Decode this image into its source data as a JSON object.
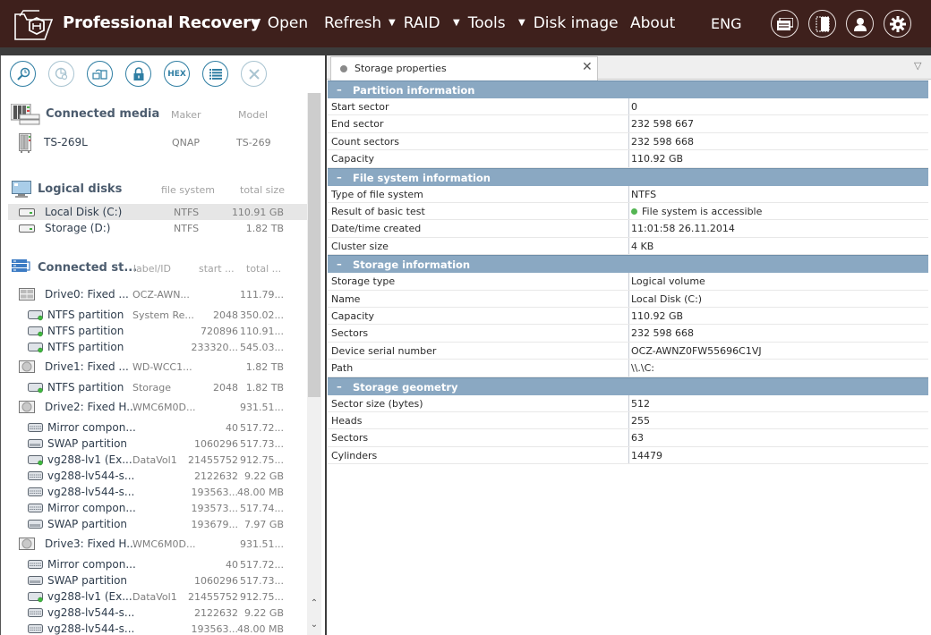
{
  "app": {
    "title": "Professional Recovery",
    "menu": [
      {
        "label": "Open",
        "dropdown": true
      },
      {
        "label": "Refresh",
        "dropdown": false
      },
      {
        "label": "RAID",
        "dropdown": true
      },
      {
        "label": "Tools",
        "dropdown": true
      },
      {
        "label": "Disk image",
        "dropdown": true
      },
      {
        "label": "About",
        "dropdown": false
      }
    ],
    "language": "ENG",
    "header_buttons": [
      "windows-icon",
      "panel-layout-icon",
      "user-icon",
      "settings-gear-icon"
    ],
    "colors": {
      "topbar": "#3e201c",
      "section_header": "#8aa8c2",
      "accent": "#2f7ea3",
      "status_ok": "#54b553"
    }
  },
  "toolbar": {
    "buttons": [
      {
        "icon": "search-scan-icon",
        "enabled": true
      },
      {
        "icon": "chart-search-icon",
        "enabled": false
      },
      {
        "icon": "image-create-icon",
        "enabled": true
      },
      {
        "icon": "lock-icon",
        "enabled": true
      },
      {
        "icon": "hex-icon",
        "label": "HEX",
        "enabled": true
      },
      {
        "icon": "list-icon",
        "enabled": true
      },
      {
        "icon": "close-icon",
        "enabled": false
      }
    ]
  },
  "connected_media": {
    "title": "Connected media",
    "columns": [
      "Maker",
      "Model"
    ],
    "items": [
      {
        "name": "TS-269L",
        "maker": "QNAP",
        "model": "TS-269"
      }
    ]
  },
  "logical_disks": {
    "title": "Logical disks",
    "columns": [
      "file system",
      "total size"
    ],
    "items": [
      {
        "name": "Local Disk (C:)",
        "fs": "NTFS",
        "size": "110.91 GB",
        "selected": true
      },
      {
        "name": "Storage (D:)",
        "fs": "NTFS",
        "size": "1.82 TB",
        "selected": false
      }
    ]
  },
  "connected_storages": {
    "title": "Connected st...",
    "columns": [
      "label/ID",
      "start ...",
      "total ..."
    ],
    "items": [
      {
        "level": 0,
        "icon": "ssd-icon",
        "name": "Drive0: Fixed ...",
        "label": "OCZ-AWN...",
        "start": "",
        "total": "111.79..."
      },
      {
        "level": 1,
        "icon": "partition-icon",
        "name": "NTFS partition",
        "label": "System Re...",
        "start": "2048",
        "total": "350.02..."
      },
      {
        "level": 1,
        "icon": "partition-icon",
        "name": "NTFS partition",
        "label": "",
        "start": "720896",
        "total": "110.91..."
      },
      {
        "level": 1,
        "icon": "partition-icon",
        "name": "NTFS partition",
        "label": "",
        "start": "233320...",
        "total": "545.03..."
      },
      {
        "level": 0,
        "icon": "hdd-icon",
        "name": "Drive1: Fixed ...",
        "label": "WD-WCC1...",
        "start": "",
        "total": "1.82 TB"
      },
      {
        "level": 1,
        "icon": "partition-icon",
        "name": "NTFS partition",
        "label": "Storage",
        "start": "2048",
        "total": "1.82 TB"
      },
      {
        "level": 0,
        "icon": "hdd-icon",
        "name": "Drive2: Fixed H...",
        "label": "WMC6M0D...",
        "start": "",
        "total": "931.51..."
      },
      {
        "level": 1,
        "icon": "raid-component-icon",
        "name": "Mirror compon...",
        "label": "",
        "start": "40",
        "total": "517.72..."
      },
      {
        "level": 1,
        "icon": "swap-icon",
        "name": "SWAP partition",
        "label": "",
        "start": "1060296",
        "total": "517.73..."
      },
      {
        "level": 1,
        "icon": "partition-icon",
        "name": "vg288-lv1 (Ex...",
        "label": "DataVol1",
        "start": "21455752",
        "total": "912.75..."
      },
      {
        "level": 1,
        "icon": "raid-component-icon",
        "name": "vg288-lv544-s...",
        "label": "",
        "start": "2122632",
        "total": "9.22 GB"
      },
      {
        "level": 1,
        "icon": "raid-component-icon",
        "name": "vg288-lv544-s...",
        "label": "",
        "start": "193563...",
        "total": "48.00 MB"
      },
      {
        "level": 1,
        "icon": "raid-component-icon",
        "name": "Mirror compon...",
        "label": "",
        "start": "193573...",
        "total": "517.74..."
      },
      {
        "level": 1,
        "icon": "swap-icon",
        "name": "SWAP partition",
        "label": "",
        "start": "193679...",
        "total": "7.97 GB"
      },
      {
        "level": 0,
        "icon": "hdd-icon",
        "name": "Drive3: Fixed H...",
        "label": "WMC6M0D...",
        "start": "",
        "total": "931.51..."
      },
      {
        "level": 1,
        "icon": "raid-component-icon",
        "name": "Mirror compon...",
        "label": "",
        "start": "40",
        "total": "517.72..."
      },
      {
        "level": 1,
        "icon": "swap-icon",
        "name": "SWAP partition",
        "label": "",
        "start": "1060296",
        "total": "517.73..."
      },
      {
        "level": 1,
        "icon": "partition-icon",
        "name": "vg288-lv1 (Ex...",
        "label": "DataVol1",
        "start": "21455752",
        "total": "912.75..."
      },
      {
        "level": 1,
        "icon": "raid-component-icon",
        "name": "vg288-lv544-s...",
        "label": "",
        "start": "2122632",
        "total": "9.22 GB"
      },
      {
        "level": 1,
        "icon": "raid-component-icon",
        "name": "vg288-lv544-s...",
        "label": "",
        "start": "193563...",
        "total": "48.00 MB"
      }
    ]
  },
  "properties": {
    "tab_label": "Storage properties",
    "sections": [
      {
        "title": "Partition information",
        "rows": [
          {
            "key": "Start sector",
            "value": "0"
          },
          {
            "key": "End sector",
            "value": "232 598 667"
          },
          {
            "key": "Count sectors",
            "value": "232 598 668"
          },
          {
            "key": "Capacity",
            "value": "110.92 GB"
          }
        ]
      },
      {
        "title": "File system information",
        "rows": [
          {
            "key": "Type of file system",
            "value": "NTFS"
          },
          {
            "key": "Result of basic test",
            "value": "File system is accessible",
            "status": "ok"
          },
          {
            "key": "Date/time created",
            "value": "11:01:58 26.11.2014"
          },
          {
            "key": "Cluster size",
            "value": "4 KB"
          }
        ]
      },
      {
        "title": "Storage information",
        "rows": [
          {
            "key": "Storage type",
            "value": "Logical volume"
          },
          {
            "key": "Name",
            "value": "Local Disk (C:)"
          },
          {
            "key": "Capacity",
            "value": "110.92 GB"
          },
          {
            "key": "Sectors",
            "value": "232 598 668"
          },
          {
            "key": "Device serial number",
            "value": "OCZ-AWNZ0FW55696C1VJ"
          },
          {
            "key": "Path",
            "value": "\\\\.\\C:"
          }
        ]
      },
      {
        "title": "Storage geometry",
        "rows": [
          {
            "key": "Sector size (bytes)",
            "value": "512"
          },
          {
            "key": "Heads",
            "value": "255"
          },
          {
            "key": "Sectors",
            "value": "63"
          },
          {
            "key": "Cylinders",
            "value": "14479"
          }
        ]
      }
    ]
  }
}
